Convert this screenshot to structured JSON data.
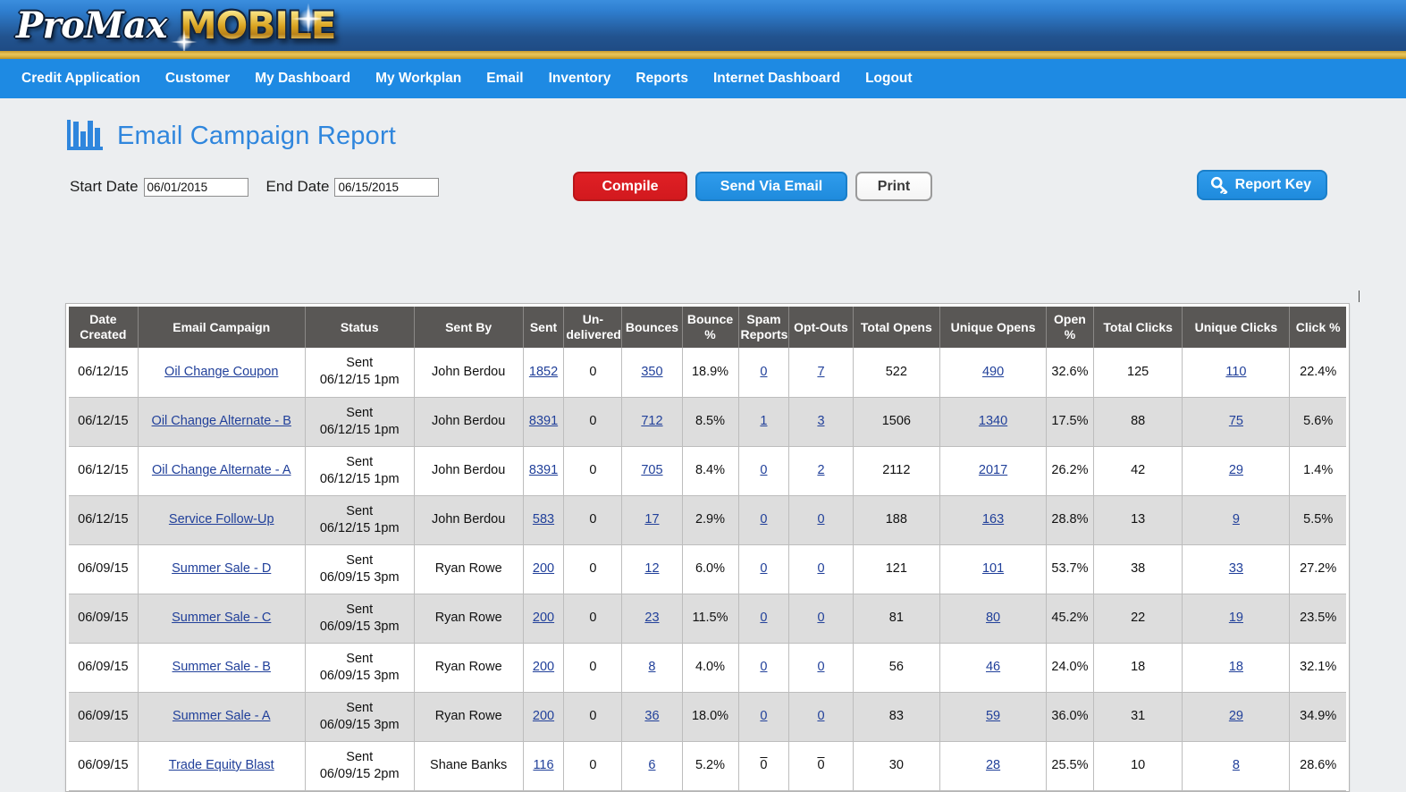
{
  "brand": {
    "logo_primary": "ProMax",
    "logo_secondary": "MOBILE",
    "header_gradient_top": "#3b8ede",
    "header_gradient_bottom": "#1d477e",
    "gold_divider": "#d4ad3c",
    "nav_background": "#1e8ae3"
  },
  "nav": {
    "items": [
      {
        "label": "Credit Application"
      },
      {
        "label": "Customer"
      },
      {
        "label": "My Dashboard"
      },
      {
        "label": "My Workplan"
      },
      {
        "label": "Email"
      },
      {
        "label": "Inventory"
      },
      {
        "label": "Reports"
      },
      {
        "label": "Internet Dashboard"
      },
      {
        "label": "Logout"
      }
    ]
  },
  "page": {
    "title": "Email Campaign Report",
    "title_color": "#2f86dd",
    "icon": "bar-chart-icon"
  },
  "toolbar": {
    "start_date_label": "Start Date",
    "start_date_value": "06/01/2015",
    "start_date_placeholder": "mm/dd/yyyy",
    "end_date_label": "End Date",
    "end_date_value": "06/15/2015",
    "end_date_placeholder": "mm/dd/yyyy",
    "compile_label": "Compile",
    "compile_color": "#d2191e",
    "send_email_label": "Send Via Email",
    "send_email_color": "#1f8bdd",
    "print_label": "Print",
    "report_key_label": "Report Key",
    "report_key_icon": "key-icon",
    "report_key_color": "#1f8bdd"
  },
  "table": {
    "header_background": "#595755",
    "alt_row_background": "#dddddd",
    "link_color": "#21409a",
    "columns": [
      {
        "label": "Date Created",
        "key": "date_created"
      },
      {
        "label": "Email Campaign",
        "key": "campaign"
      },
      {
        "label": "Status",
        "key": "status"
      },
      {
        "label": "Sent By",
        "key": "sent_by"
      },
      {
        "label": "Sent",
        "key": "sent"
      },
      {
        "label": "Un-delivered",
        "key": "undelivered"
      },
      {
        "label": "Bounces",
        "key": "bounces"
      },
      {
        "label": "Bounce %",
        "key": "bounce_pct"
      },
      {
        "label": "Spam Reports",
        "key": "spam_reports"
      },
      {
        "label": "Opt-Outs",
        "key": "opt_outs"
      },
      {
        "label": "Total Opens",
        "key": "total_opens"
      },
      {
        "label": "Unique Opens",
        "key": "unique_opens"
      },
      {
        "label": "Open %",
        "key": "open_pct"
      },
      {
        "label": "Total Clicks",
        "key": "total_clicks"
      },
      {
        "label": "Unique Clicks",
        "key": "unique_clicks"
      },
      {
        "label": "Click %",
        "key": "click_pct"
      }
    ],
    "rows": [
      {
        "date_created": "06/12/15",
        "campaign": "Oil Change Coupon",
        "status_line1": "Sent",
        "status_line2": "06/12/15 1pm",
        "sent_by": "John Berdou",
        "sent": "1852",
        "undelivered": "0",
        "bounces": "350",
        "bounce_pct": "18.9%",
        "spam_reports": "0",
        "opt_outs": "7",
        "total_opens": "522",
        "unique_opens": "490",
        "open_pct": "32.6%",
        "total_clicks": "125",
        "unique_clicks": "110",
        "click_pct": "22.4%"
      },
      {
        "date_created": "06/12/15",
        "campaign": "Oil Change Alternate - B",
        "status_line1": "Sent",
        "status_line2": "06/12/15 1pm",
        "sent_by": "John Berdou",
        "sent": "8391",
        "undelivered": "0",
        "bounces": "712",
        "bounce_pct": "8.5%",
        "spam_reports": "1",
        "opt_outs": "3",
        "total_opens": "1506",
        "unique_opens": "1340",
        "open_pct": "17.5%",
        "total_clicks": "88",
        "unique_clicks": "75",
        "click_pct": "5.6%"
      },
      {
        "date_created": "06/12/15",
        "campaign": "Oil Change Alternate - A",
        "status_line1": "Sent",
        "status_line2": "06/12/15 1pm",
        "sent_by": "John Berdou",
        "sent": "8391",
        "undelivered": "0",
        "bounces": "705",
        "bounce_pct": "8.4%",
        "spam_reports": "0",
        "opt_outs": "2",
        "total_opens": "2112",
        "unique_opens": "2017",
        "open_pct": "26.2%",
        "total_clicks": "42",
        "unique_clicks": "29",
        "click_pct": "1.4%"
      },
      {
        "date_created": "06/12/15",
        "campaign": "Service Follow-Up",
        "status_line1": "Sent",
        "status_line2": "06/12/15 1pm",
        "sent_by": "John Berdou",
        "sent": "583",
        "undelivered": "0",
        "bounces": "17",
        "bounce_pct": "2.9%",
        "spam_reports": "0",
        "opt_outs": "0",
        "total_opens": "188",
        "unique_opens": "163",
        "open_pct": "28.8%",
        "total_clicks": "13",
        "unique_clicks": "9",
        "click_pct": "5.5%"
      },
      {
        "date_created": "06/09/15",
        "campaign": "Summer Sale - D",
        "status_line1": "Sent",
        "status_line2": "06/09/15 3pm",
        "sent_by": "Ryan Rowe",
        "sent": "200",
        "undelivered": "0",
        "bounces": "12",
        "bounce_pct": "6.0%",
        "spam_reports": "0",
        "opt_outs": "0",
        "total_opens": "121",
        "unique_opens": "101",
        "open_pct": "53.7%",
        "total_clicks": "38",
        "unique_clicks": "33",
        "click_pct": "27.2%"
      },
      {
        "date_created": "06/09/15",
        "campaign": "Summer Sale - C",
        "status_line1": "Sent",
        "status_line2": "06/09/15 3pm",
        "sent_by": "Ryan Rowe",
        "sent": "200",
        "undelivered": "0",
        "bounces": "23",
        "bounce_pct": "11.5%",
        "spam_reports": "0",
        "opt_outs": "0",
        "total_opens": "81",
        "unique_opens": "80",
        "open_pct": "45.2%",
        "total_clicks": "22",
        "unique_clicks": "19",
        "click_pct": "23.5%"
      },
      {
        "date_created": "06/09/15",
        "campaign": "Summer Sale - B",
        "status_line1": "Sent",
        "status_line2": "06/09/15 3pm",
        "sent_by": "Ryan Rowe",
        "sent": "200",
        "undelivered": "0",
        "bounces": "8",
        "bounce_pct": "4.0%",
        "spam_reports": "0",
        "opt_outs": "0",
        "total_opens": "56",
        "unique_opens": "46",
        "open_pct": "24.0%",
        "total_clicks": "18",
        "unique_clicks": "18",
        "click_pct": "32.1%"
      },
      {
        "date_created": "06/09/15",
        "campaign": "Summer Sale - A",
        "status_line1": "Sent",
        "status_line2": "06/09/15 3pm",
        "sent_by": "Ryan Rowe",
        "sent": "200",
        "undelivered": "0",
        "bounces": "36",
        "bounce_pct": "18.0%",
        "spam_reports": "0",
        "opt_outs": "0",
        "total_opens": "83",
        "unique_opens": "59",
        "open_pct": "36.0%",
        "total_clicks": "31",
        "unique_clicks": "29",
        "click_pct": "34.9%"
      },
      {
        "date_created": "06/09/15",
        "campaign": "Trade Equity Blast",
        "status_line1": "Sent",
        "status_line2": "06/09/15 2pm",
        "sent_by": "Shane Banks",
        "sent": "116",
        "undelivered": "0",
        "bounces": "6",
        "bounce_pct": "5.2%",
        "spam_reports": "0",
        "opt_outs": "0",
        "total_opens": "30",
        "unique_opens": "28",
        "open_pct": "25.5%",
        "total_clicks": "10",
        "unique_clicks": "8",
        "click_pct": "28.6%"
      }
    ]
  }
}
